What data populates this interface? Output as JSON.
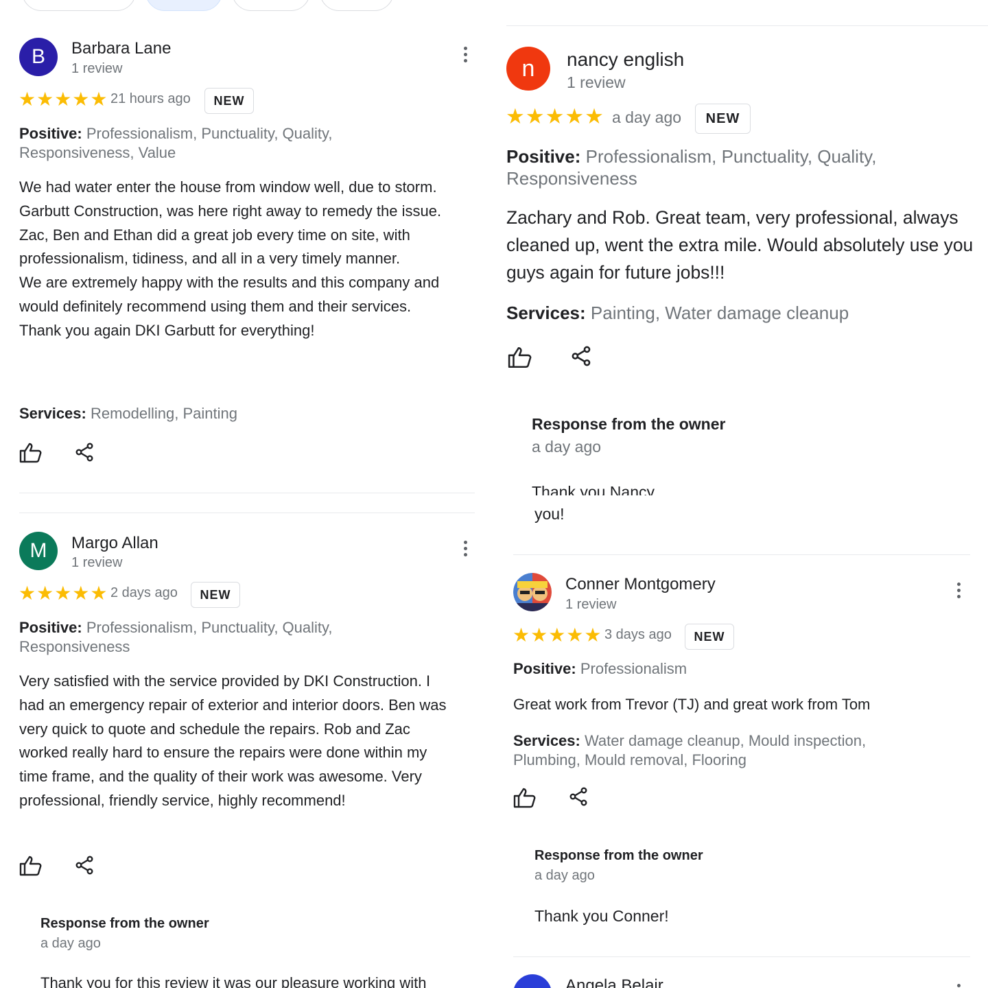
{
  "reviews": [
    {
      "initial": "B",
      "name": "Barbara Lane",
      "count": "1 review",
      "stars": "★★★★★",
      "ago": "21 hours ago",
      "badge": "NEW",
      "positive_label": "Positive:",
      "positive": "Professionalism, Punctuality, Quality, Responsiveness, Value",
      "text": "We had water enter the house from window well, due to storm. Garbutt Construction, was here right away to remedy the issue. Zac, Ben and Ethan did a great job every time on site, with professionalism, tidiness, and all in a very timely manner.\nWe are extremely happy with the results and this company and would definitely recommend using them and their services.\nThank you again DKI Garbutt for everything!",
      "services_label": "Services:",
      "services": "Remodelling, Painting",
      "avatar_color": "#2a1ea8"
    },
    {
      "initial": "M",
      "name": "Margo Allan",
      "count": "1 review",
      "stars": "★★★★★",
      "ago": "2 days ago",
      "badge": "NEW",
      "positive_label": "Positive:",
      "positive": "Professionalism, Punctuality, Quality, Responsiveness",
      "text": "Very satisfied with the service provided by DKI Construction. I had an emergency repair of exterior and interior doors. Ben was very quick to quote and schedule the repairs. Rob and Zac worked really hard to ensure the repairs were done within my time frame, and the quality of their work was awesome. Very professional, friendly service, highly recommend!",
      "response_title": "Response from the owner",
      "response_ago": "a day ago",
      "response_text": "Thank you for this review it was our pleasure working with",
      "avatar_color": "#0b7a5a"
    },
    {
      "initial": "n",
      "name": "nancy english",
      "count": "1 review",
      "stars": "★★★★★",
      "ago": "a day ago",
      "badge": "NEW",
      "positive_label": "Positive:",
      "positive": "Professionalism, Punctuality, Quality, Responsiveness",
      "text": "Zachary and Rob.  Great team, very professional, always cleaned up, went the extra mile.  Would absolutely use you guys again for future jobs!!!",
      "services_label": "Services:",
      "services": "Painting, Water damage cleanup",
      "response_title": "Response from the owner",
      "response_ago": "a day ago",
      "response_text_glitch": "Thank you Nancy",
      "response_text_end": "you!",
      "avatar_color": "#f0380f"
    },
    {
      "name": "Conner Montgomery",
      "count": "1 review",
      "stars": "★★★★★",
      "ago": "3 days ago",
      "badge": "NEW",
      "positive_label": "Positive:",
      "positive": "Professionalism",
      "text": "Great work from Trevor (TJ) and great work from Tom",
      "services_label": "Services:",
      "services": "Water damage cleanup, Mould inspection, Plumbing, Mould removal, Flooring",
      "response_title": "Response from the owner",
      "response_ago": "a day ago",
      "response_text": "Thank you Conner!"
    },
    {
      "name": "Angela Belair",
      "avatar_color": "#2a3ed8"
    }
  ]
}
